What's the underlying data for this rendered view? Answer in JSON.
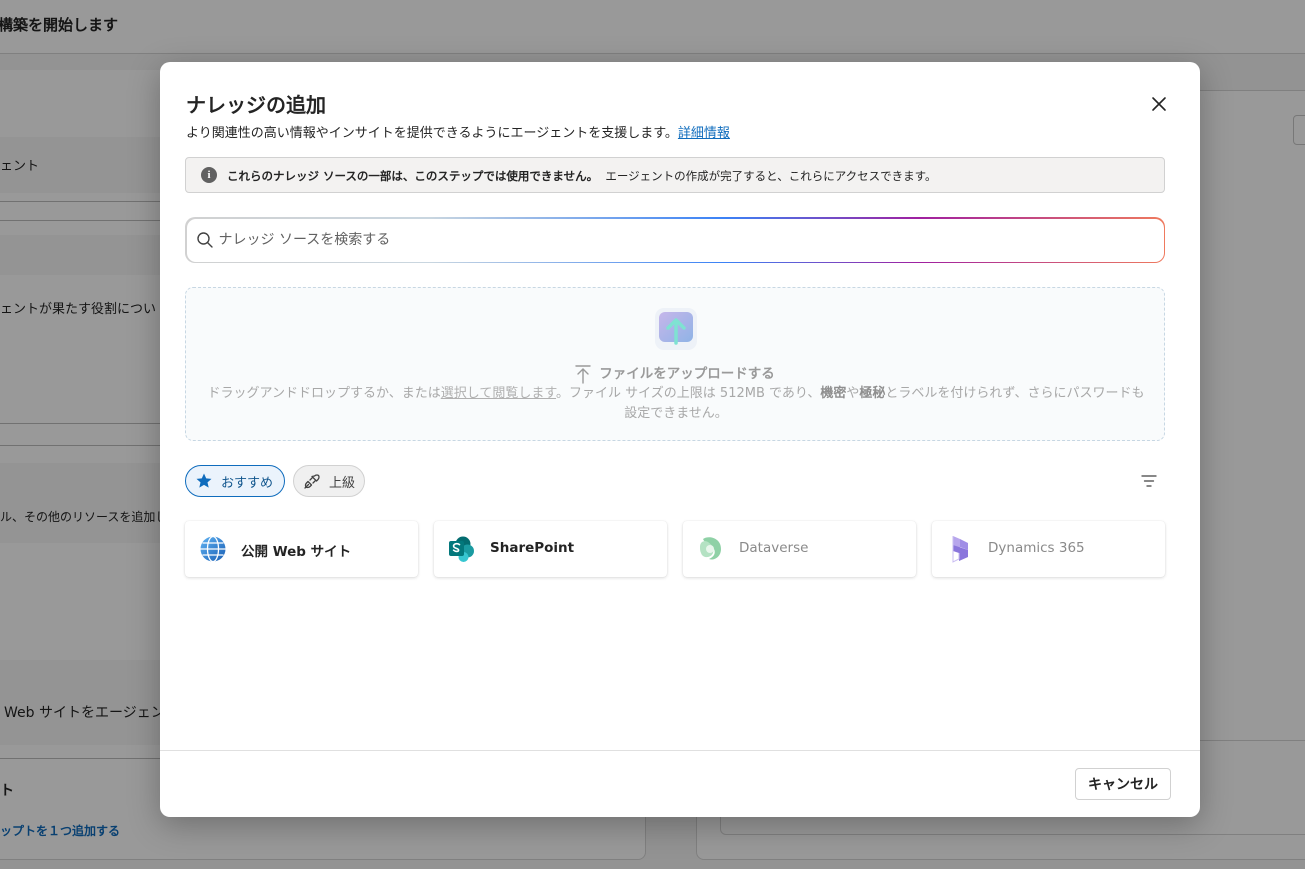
{
  "background": {
    "header_title": "構築を開始します",
    "left_texts": {
      "agent_name_label": "ェント",
      "role_label": "ェントが果たす役割につい",
      "resources_text": "ル、その他のリソースを追加し",
      "web_text": "Web サイトをエージェン",
      "section_t": "ト",
      "add_prompt_link": "ップトを１つ追加する"
    }
  },
  "dialog": {
    "title": "ナレッジの追加",
    "subtitle": "より関連性の高い情報やインサイトを提供できるようにエージェントを支援します。",
    "learn_more": "詳細情報",
    "info": {
      "icon_glyph": "i",
      "bold": "これらのナレッジ ソースの一部は、このステップでは使用できません。",
      "text": "エージェントの作成が完了すると、これらにアクセスできます。"
    },
    "search": {
      "placeholder": "ナレッジ ソースを検索する",
      "value": ""
    },
    "upload": {
      "title": "ファイルをアップロードする",
      "desc_1": "ドラッグアンドドロップするか、または",
      "select_link": "選択して閲覧します",
      "desc_2": "。ファイル サイズの上限は 512MB であり、",
      "bold_1": "機密",
      "desc_3": "や",
      "bold_2": "極秘",
      "desc_4": "とラベルを付けられず、さらにパスワードも設定できません。"
    },
    "filters": [
      {
        "label": "おすすめ",
        "icon": "star-icon",
        "selected": true
      },
      {
        "label": "上級",
        "icon": "plug-icon",
        "selected": false
      }
    ],
    "sources": [
      {
        "label": "公開 Web サイト",
        "icon": "globe-icon",
        "enabled": true
      },
      {
        "label": "SharePoint",
        "icon": "sharepoint-icon",
        "enabled": true
      },
      {
        "label": "Dataverse",
        "icon": "dataverse-icon",
        "enabled": false
      },
      {
        "label": "Dynamics 365",
        "icon": "dynamics-365-icon",
        "enabled": false
      }
    ],
    "cancel_label": "キャンセル",
    "colors": {
      "accent": "#0f6cbd",
      "chip_selected_bg": "#ebf3fc",
      "disabled_text": "#8a8a8a"
    }
  }
}
